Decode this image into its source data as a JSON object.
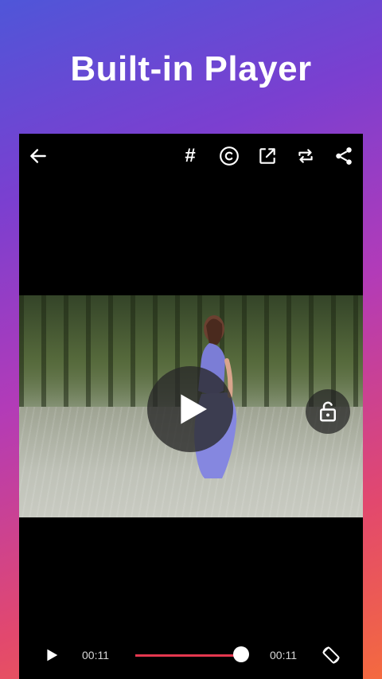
{
  "headline": "Built-in Player",
  "toolbar": {
    "hashtag_label": "#",
    "icons": [
      "back-arrow-icon",
      "hashtag-icon",
      "copyright-icon",
      "open-external-icon",
      "repeat-icon",
      "share-icon"
    ]
  },
  "player": {
    "state": "paused",
    "lock_state": "unlocked",
    "current_time": "00:11",
    "total_time": "00:11",
    "progress": 1.0,
    "accent_color": "#e5384f"
  }
}
